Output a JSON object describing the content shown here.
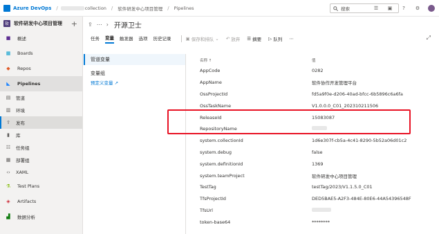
{
  "topbar": {
    "brand": "Azure DevOps",
    "collection": "collection",
    "project": "软件研发中心项目管理",
    "section": "Pipelines",
    "search_placeholder": "搜索"
  },
  "sidebar": {
    "project_badge": "软",
    "project_name": "软件研发中心项目管理",
    "items": [
      {
        "label": "概述",
        "icon": "overview-icon"
      },
      {
        "label": "Boards",
        "icon": "boards-icon"
      },
      {
        "label": "Repos",
        "icon": "repos-icon"
      },
      {
        "label": "Pipelines",
        "icon": "pipelines-icon"
      },
      {
        "label": "管道",
        "icon": "pipeline-icon"
      },
      {
        "label": "环境",
        "icon": "environment-icon"
      },
      {
        "label": "发布",
        "icon": "release-icon"
      },
      {
        "label": "库",
        "icon": "library-icon"
      },
      {
        "label": "任务组",
        "icon": "task-group-icon"
      },
      {
        "label": "部署组",
        "icon": "deployment-group-icon"
      },
      {
        "label": "XAML",
        "icon": "xaml-icon"
      },
      {
        "label": "Test Plans",
        "icon": "test-plans-icon"
      },
      {
        "label": "Artifacts",
        "icon": "artifacts-icon"
      },
      {
        "label": "数据分析",
        "icon": "analytics-icon"
      }
    ]
  },
  "main": {
    "title": "开源卫士",
    "tabs": [
      "任务",
      "变量",
      "触发器",
      "选项",
      "历史记录"
    ],
    "actions": {
      "save_queue": "保存和排队",
      "discard": "放弃",
      "summary": "摘要",
      "queue": "队列"
    },
    "left_panel": {
      "pipeline_vars": "管道变量",
      "var_groups": "变量组",
      "predefined": "预定义变量"
    },
    "grid": {
      "col_name": "名称 ↑",
      "col_value": "值",
      "rows": [
        {
          "name": "AppCode",
          "value": "0282"
        },
        {
          "name": "AppName",
          "value": "软件协作开发管理平台"
        },
        {
          "name": "OssProjectId",
          "value": "fd5a9f0e-d206-40ad-bfcc-6b5896c6a6fa"
        },
        {
          "name": "OssTaskName",
          "value": "V1.0.0.0_C01_202310211506"
        },
        {
          "name": "ReleaseId",
          "value": "15083087"
        },
        {
          "name": "RepositoryName",
          "value": ""
        },
        {
          "name": "system.collectionId",
          "value": "1d6e307f-cb5a-4c41-8290-5b52a06d01c2"
        },
        {
          "name": "system.debug",
          "value": "false"
        },
        {
          "name": "system.definitionId",
          "value": "1369"
        },
        {
          "name": "system.teamProject",
          "value": "软件研发中心项目管理"
        },
        {
          "name": "TestTag",
          "value": "testTag/2023/V1.1.5.0_C01"
        },
        {
          "name": "TfsProjectId",
          "value": "DED5BAE5-A2F3-484E-80E6-44A54396548F"
        },
        {
          "name": "TfsUrl",
          "value": ""
        },
        {
          "name": "token-base64",
          "value": "********"
        }
      ]
    }
  },
  "colors": {
    "accent": "#0078d4",
    "highlight": "#e81123"
  }
}
